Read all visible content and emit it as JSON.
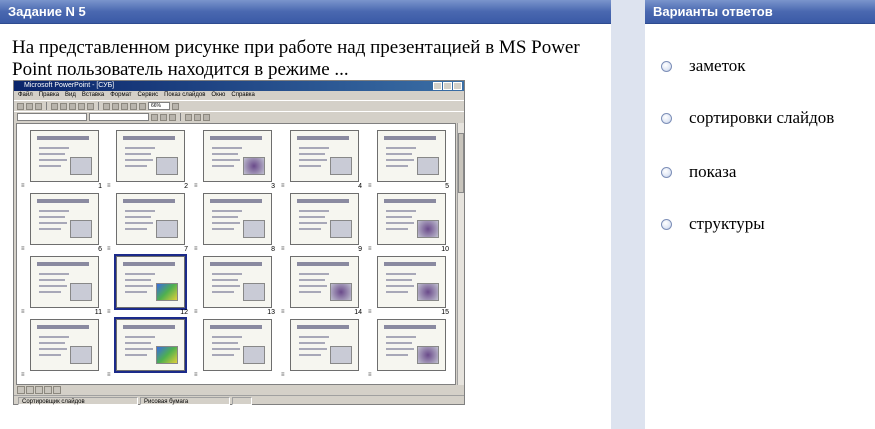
{
  "question_panel": {
    "header": "Задание N 5",
    "text": "На представленном рисунке при работе над презентацией в MS Power Point пользователь находится в режиме ..."
  },
  "answers_panel": {
    "header": "Варианты ответов",
    "options": [
      {
        "label": "заметок"
      },
      {
        "label": "сортировки слайдов"
      },
      {
        "label": "показа"
      },
      {
        "label": "структуры"
      }
    ]
  },
  "screenshot": {
    "window_title": "Microsoft PowerPoint - [СУБ]",
    "menu": [
      "Файл",
      "Правка",
      "Вид",
      "Вставка",
      "Формат",
      "Сервис",
      "Показ слайдов",
      "Окно",
      "Справка"
    ],
    "zoom": "66%",
    "status_view": "Сортировщик слайдов",
    "status_template": "Рисовая бумага",
    "slide_numbers": [
      "1",
      "2",
      "3",
      "4",
      "5",
      "6",
      "7",
      "8",
      "9",
      "10",
      "11",
      "12",
      "13",
      "14",
      "15"
    ],
    "selected_slides": [
      12,
      17
    ],
    "colors": {
      "title_bar": "#0a246a",
      "header_bar": "#4a68b0"
    }
  }
}
